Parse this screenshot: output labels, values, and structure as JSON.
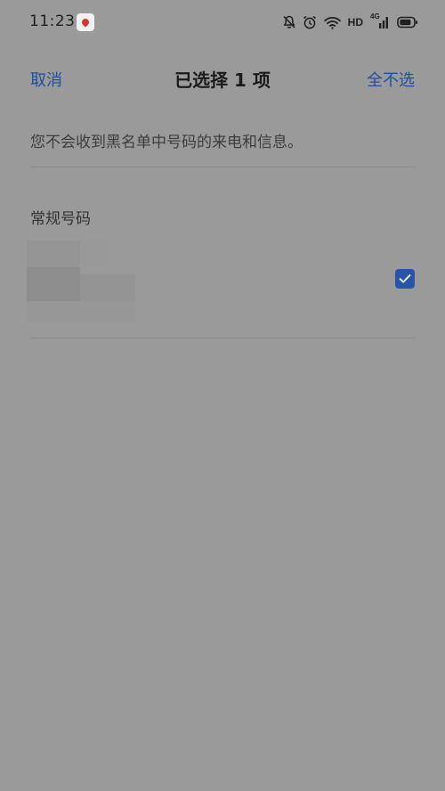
{
  "status_bar": {
    "time": "11:23",
    "hd_label": "HD",
    "network_label": "4G",
    "icons": [
      "map-pin-app-icon",
      "mute-bell-icon",
      "alarm-icon",
      "wifi-icon",
      "signal-icon",
      "battery-icon"
    ]
  },
  "header": {
    "cancel_label": "取消",
    "title": "已选择 1 项",
    "deselect_all_label": "全不选"
  },
  "notice": {
    "text": "您不会收到黑名单中号码的来电和信息。"
  },
  "section": {
    "title": "常规号码"
  },
  "list": {
    "items": [
      {
        "checked": true
      }
    ]
  },
  "colors": {
    "background": "#9a9a9a",
    "accent": "#1f4fa0",
    "checkbox": "#2855a8"
  }
}
